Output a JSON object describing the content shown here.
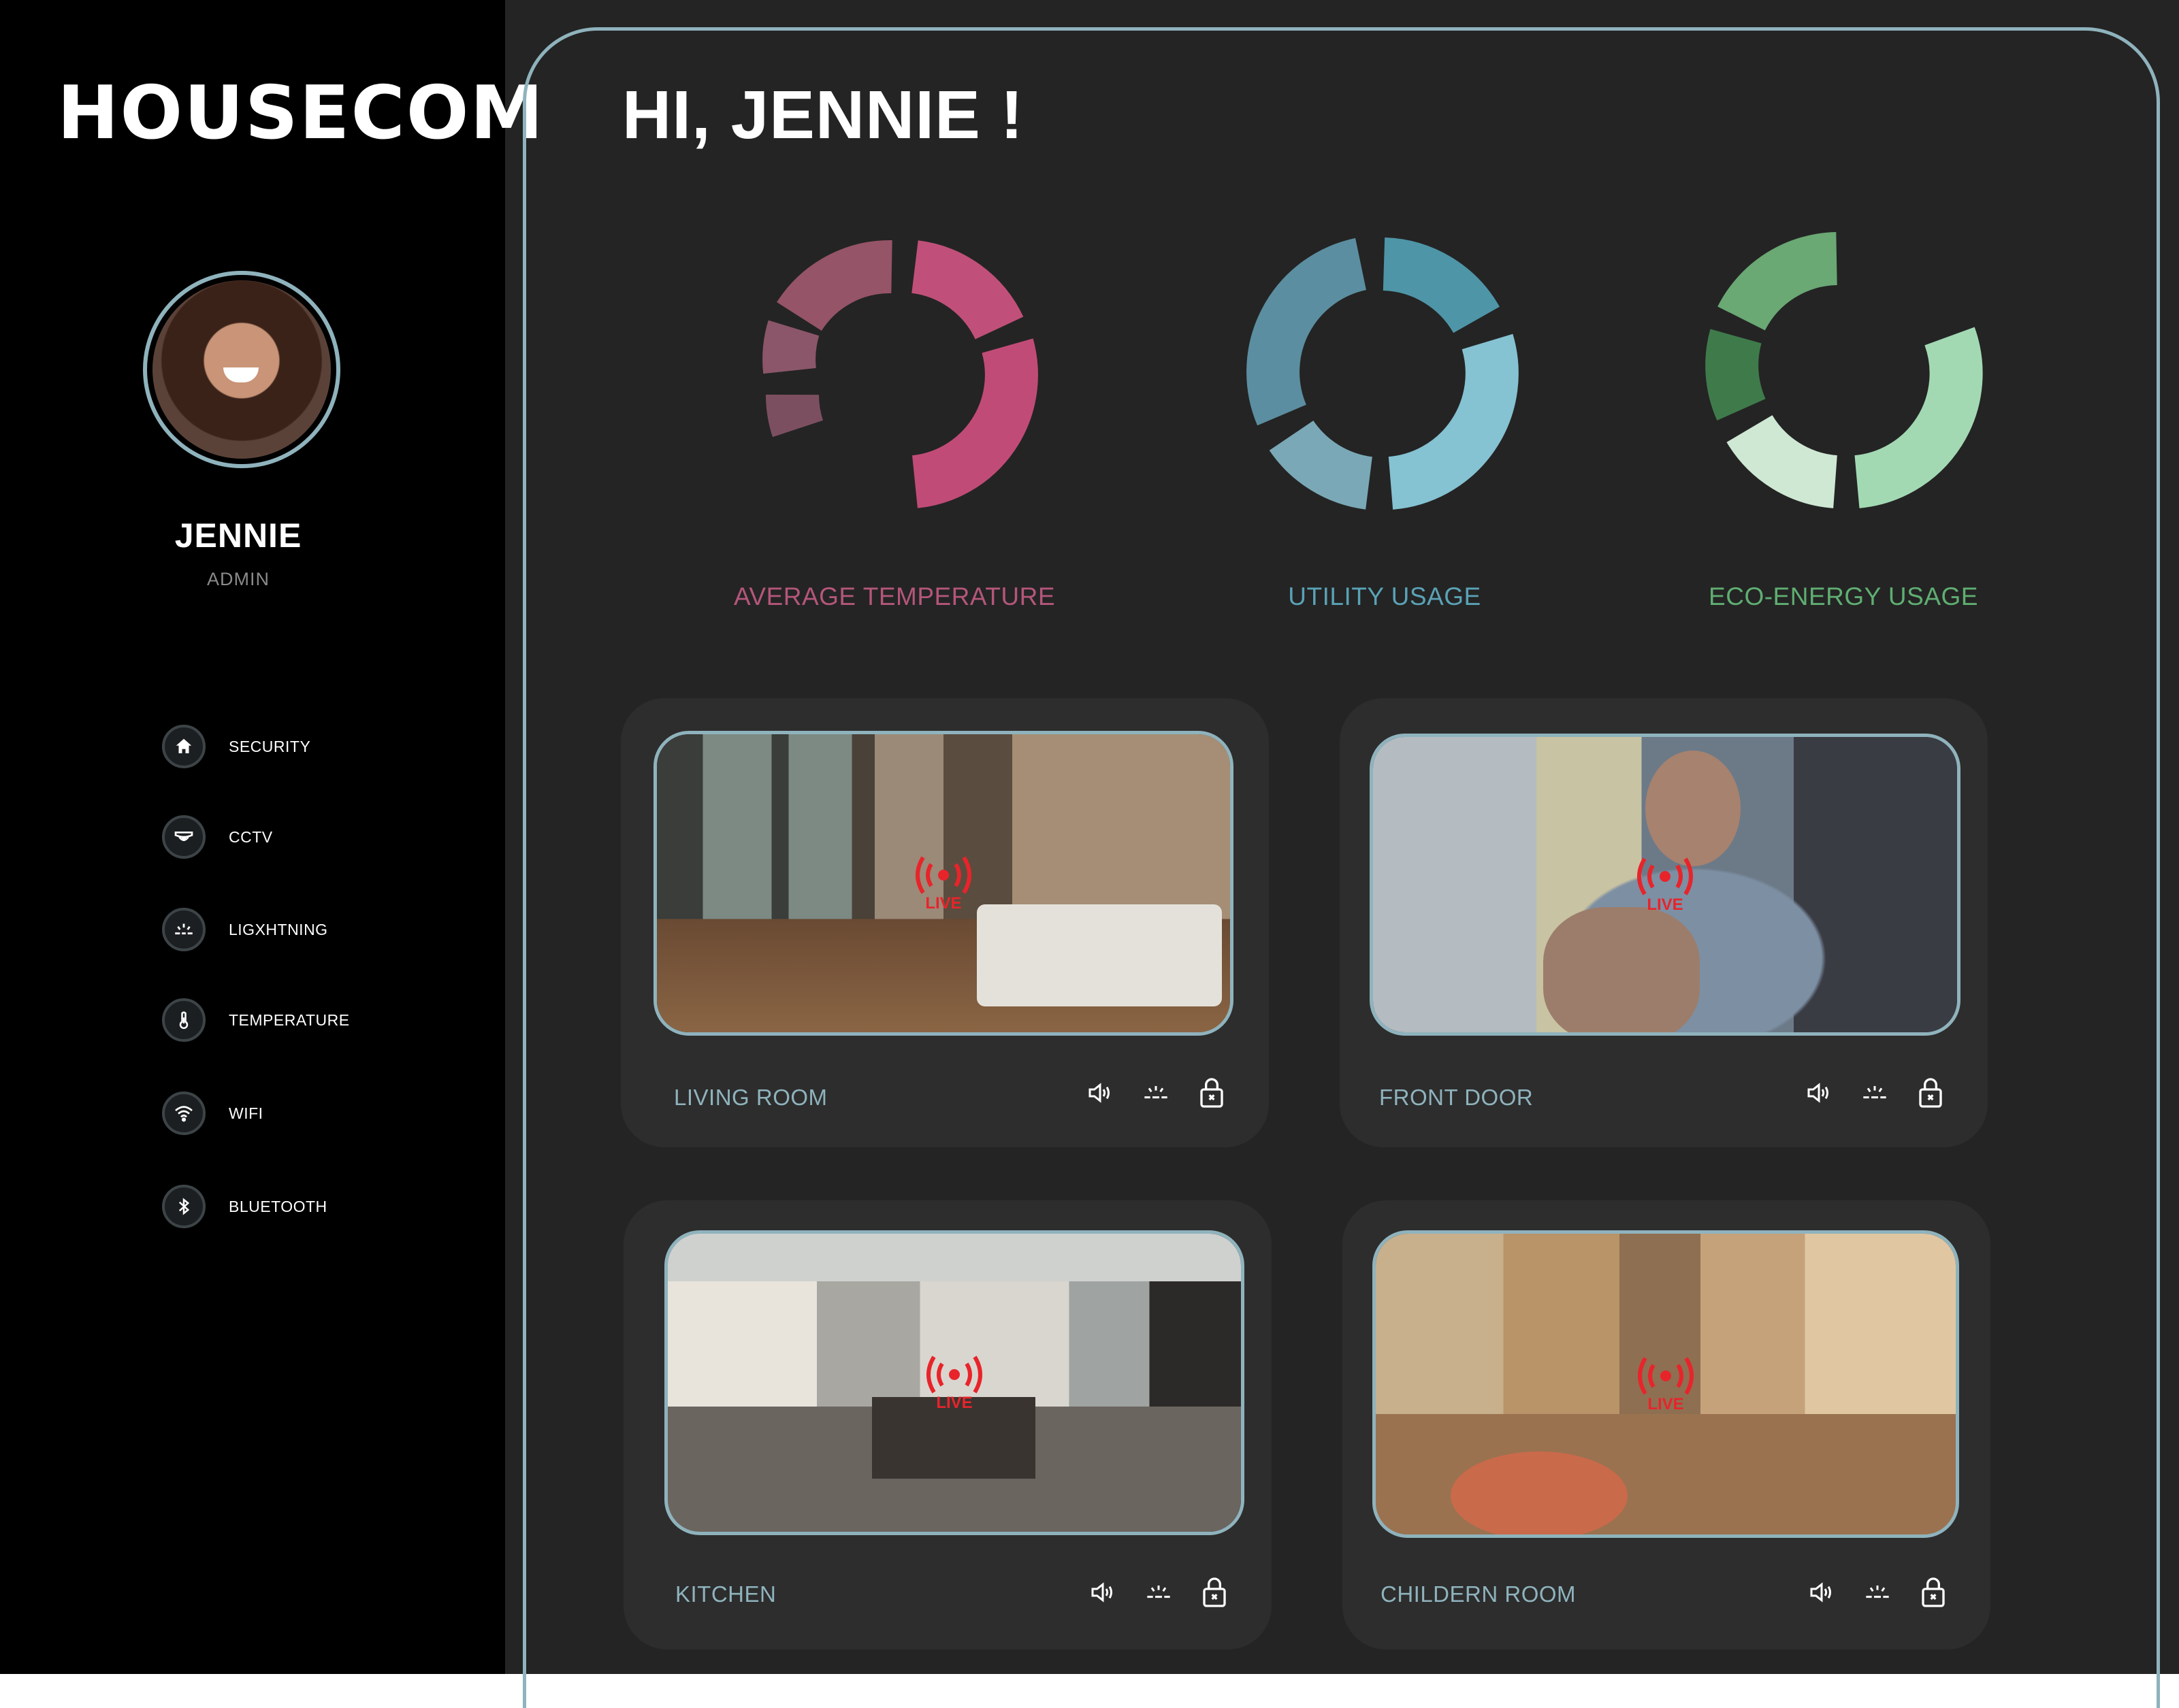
{
  "brand": {
    "name": "HOUSECOM"
  },
  "user": {
    "name": "JENNIE",
    "role": "ADMIN"
  },
  "sidebar": {
    "items": [
      {
        "label": "SECURITY",
        "icon": "home-icon"
      },
      {
        "label": "CCTV",
        "icon": "camera-icon"
      },
      {
        "label": "LIGXHTNING",
        "icon": "lightning-icon"
      },
      {
        "label": "TEMPERATURE",
        "icon": "thermometer-icon"
      },
      {
        "label": "WIFI",
        "icon": "wifi-icon"
      },
      {
        "label": "BLUETOOTH",
        "icon": "bluetooth-icon"
      }
    ]
  },
  "greeting": "HI, JENNIE !",
  "gauges": [
    {
      "label": "AVERAGE TEMPERATURE",
      "color": "#b0506e"
    },
    {
      "label": "UTILITY USAGE",
      "color": "#5ea7bb"
    },
    {
      "label": "ECO-ENERGY USAGE",
      "color": "#5fae72"
    }
  ],
  "cameras": [
    {
      "title": "LIVING ROOM",
      "live": "LIVE"
    },
    {
      "title": "FRONT DOOR",
      "live": "LIVE"
    },
    {
      "title": "KITCHEN",
      "live": "LIVE"
    },
    {
      "title": "CHILDERN ROOM",
      "live": "LIVE"
    }
  ],
  "colors": {
    "accent": "#8fb3bd",
    "live": "#e8242b",
    "sidebar": "#000000",
    "panel": "#242424"
  }
}
